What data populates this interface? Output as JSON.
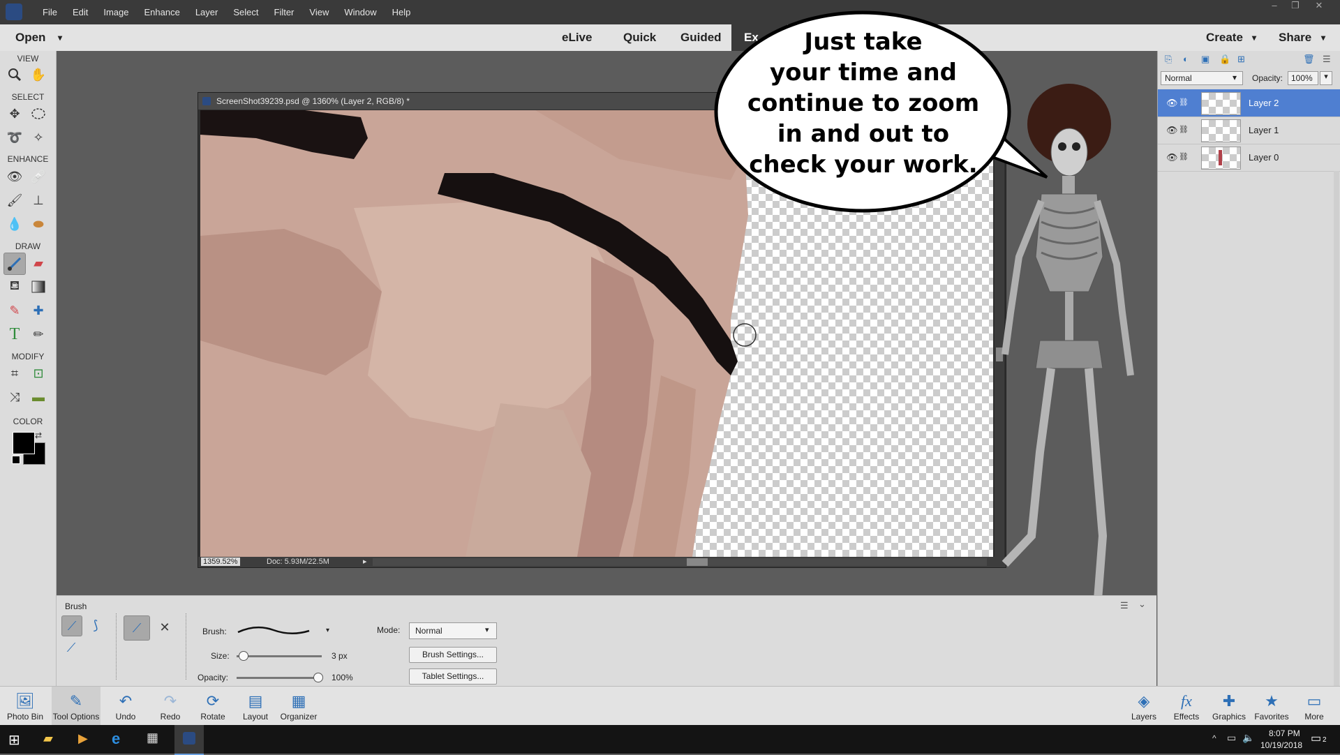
{
  "menubar": {
    "items": [
      "File",
      "Edit",
      "Image",
      "Enhance",
      "Layer",
      "Select",
      "Filter",
      "View",
      "Window",
      "Help"
    ]
  },
  "modebar": {
    "open_label": "Open",
    "tabs": [
      "eLive",
      "Quick",
      "Guided",
      "Ex"
    ],
    "create_label": "Create",
    "share_label": "Share"
  },
  "toolbox": {
    "sections": [
      "VIEW",
      "SELECT",
      "ENHANCE",
      "DRAW",
      "MODIFY",
      "COLOR"
    ]
  },
  "document": {
    "title": "ScreenShot39239.psd @ 1360% (Layer 2, RGB/8) *",
    "zoom": "1359.52%",
    "doc_size": "Doc: 5.93M/22.5M"
  },
  "bubble": {
    "lines": [
      "Just take",
      "your time and",
      "continue to zoom",
      "in and out to",
      "check your work."
    ]
  },
  "layers": {
    "blend_mode": "Normal",
    "opacity_label": "Opacity:",
    "opacity_value": "100%",
    "items": [
      {
        "name": "Layer 2",
        "selected": true
      },
      {
        "name": "Layer 1",
        "selected": false
      },
      {
        "name": "Layer 0",
        "selected": false
      }
    ]
  },
  "tool_options": {
    "tool_name": "Brush",
    "brush_label": "Brush:",
    "size_label": "Size:",
    "size_value": "3 px",
    "opacity_label": "Opacity:",
    "opacity_value": "100%",
    "opacity_fraction": 1.0,
    "size_fraction": 0.03,
    "mode_label": "Mode:",
    "mode_value": "Normal",
    "brush_settings": "Brush Settings...",
    "tablet_settings": "Tablet Settings..."
  },
  "bottombar": {
    "left": [
      {
        "label": "Photo Bin",
        "icon": "photo-bin-icon"
      },
      {
        "label": "Tool Options",
        "icon": "tool-options-icon"
      },
      {
        "label": "Undo",
        "icon": "undo-icon"
      },
      {
        "label": "Redo",
        "icon": "redo-icon"
      },
      {
        "label": "Rotate",
        "icon": "rotate-icon"
      },
      {
        "label": "Layout",
        "icon": "layout-icon"
      },
      {
        "label": "Organizer",
        "icon": "organizer-icon"
      }
    ],
    "right": [
      {
        "label": "Layers",
        "icon": "layers-icon"
      },
      {
        "label": "Effects",
        "icon": "effects-icon"
      },
      {
        "label": "Graphics",
        "icon": "graphics-icon"
      },
      {
        "label": "Favorites",
        "icon": "favorites-icon"
      },
      {
        "label": "More",
        "icon": "more-icon"
      }
    ]
  },
  "taskbar": {
    "time": "8:07 PM",
    "date": "10/19/2018",
    "notification_count": "2"
  },
  "colors": {
    "accent": "#4f7fd1",
    "foreground": "#000000",
    "background": "#000000"
  }
}
